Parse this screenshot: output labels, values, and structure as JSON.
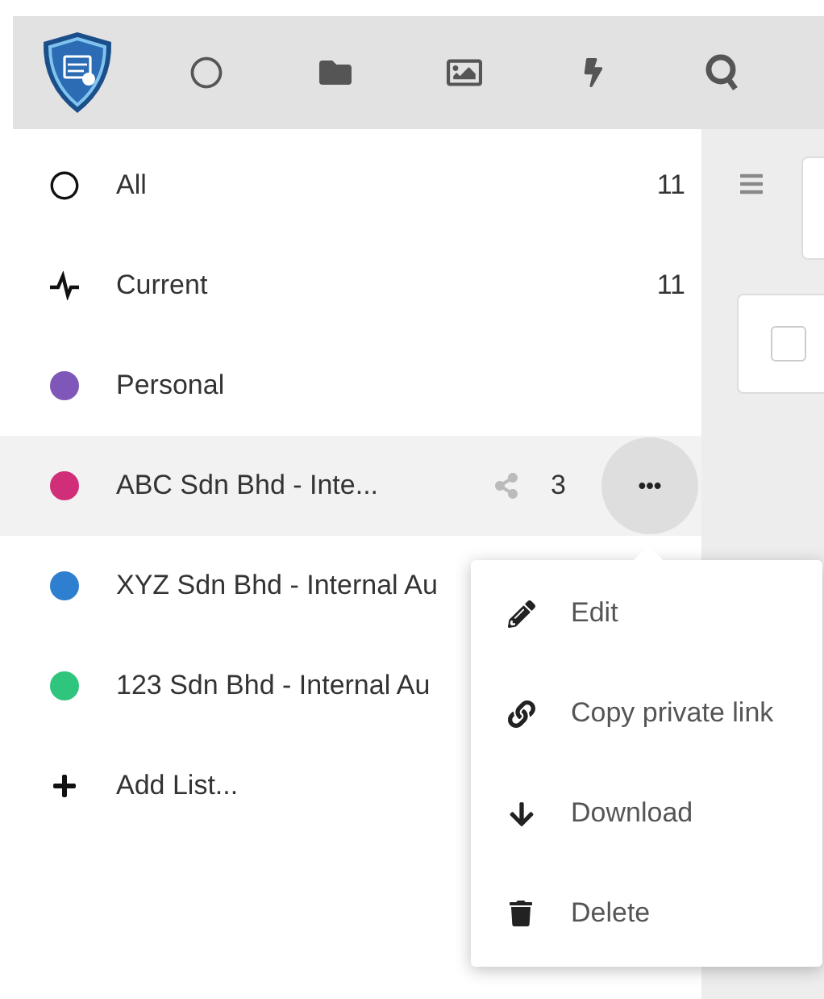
{
  "sidebar": {
    "items": [
      {
        "kind": "all",
        "label": "All",
        "count": "11",
        "selected": false
      },
      {
        "kind": "current",
        "label": "Current",
        "count": "11",
        "selected": false
      },
      {
        "kind": "list",
        "label": "Personal",
        "color": "#7e57b8",
        "selected": false
      },
      {
        "kind": "list",
        "label": "ABC Sdn Bhd - Inte...",
        "color": "#d12e7a",
        "shares": "3",
        "selected": true
      },
      {
        "kind": "list",
        "label": "XYZ Sdn Bhd - Internal Au",
        "color": "#2f7fd0",
        "selected": false
      },
      {
        "kind": "list",
        "label": "123 Sdn Bhd - Internal Au",
        "color": "#2fc57c",
        "selected": false
      },
      {
        "kind": "add",
        "label": "Add List...",
        "selected": false
      }
    ]
  },
  "context_menu": {
    "items": [
      {
        "kind": "edit",
        "label": "Edit"
      },
      {
        "kind": "link",
        "label": "Copy private link"
      },
      {
        "kind": "download",
        "label": "Download"
      },
      {
        "kind": "delete",
        "label": "Delete"
      }
    ]
  },
  "task_card": {
    "checked": false
  }
}
